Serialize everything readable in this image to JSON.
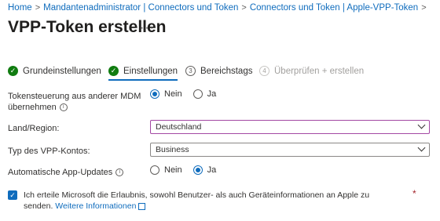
{
  "breadcrumb": {
    "items": [
      "Home",
      "Mandantenadministrator | Connectors und Token",
      "Connectors und Token | Apple-VPP-Token"
    ]
  },
  "page": {
    "title": "VPP-Token erstellen",
    "more": "···"
  },
  "steps": [
    {
      "label": "Grundeinstellungen",
      "state": "done",
      "icon": "check"
    },
    {
      "label": "Einstellungen",
      "state": "active",
      "icon": "check"
    },
    {
      "label": "Bereichstags",
      "state": "pending",
      "number": "3"
    },
    {
      "label": "Überprüfen + erstellen",
      "state": "disabled",
      "number": "4"
    }
  ],
  "fields": {
    "token_control": {
      "label_line1": "Tokensteuerung aus anderer MDM",
      "label_line2": "übernehmen",
      "options": [
        "Nein",
        "Ja"
      ],
      "selected": "Nein"
    },
    "country": {
      "label": "Land/Region:",
      "value": "Deutschland"
    },
    "account_type": {
      "label": "Typ des VPP-Kontos:",
      "value": "Business"
    },
    "auto_updates": {
      "label": "Automatische App-Updates",
      "options": [
        "Nein",
        "Ja"
      ],
      "selected": "Ja"
    }
  },
  "consent": {
    "text": "Ich erteile Microsoft die Erlaubnis, sowohl Benutzer- als auch Geräteinformationen an Apple zu senden.",
    "link": "Weitere Informationen",
    "required_mark": "*",
    "checked": true
  },
  "colors": {
    "accent": "#0f6cbd",
    "success": "#107c10",
    "required": "#a4262c",
    "focus": "#a347a3"
  }
}
